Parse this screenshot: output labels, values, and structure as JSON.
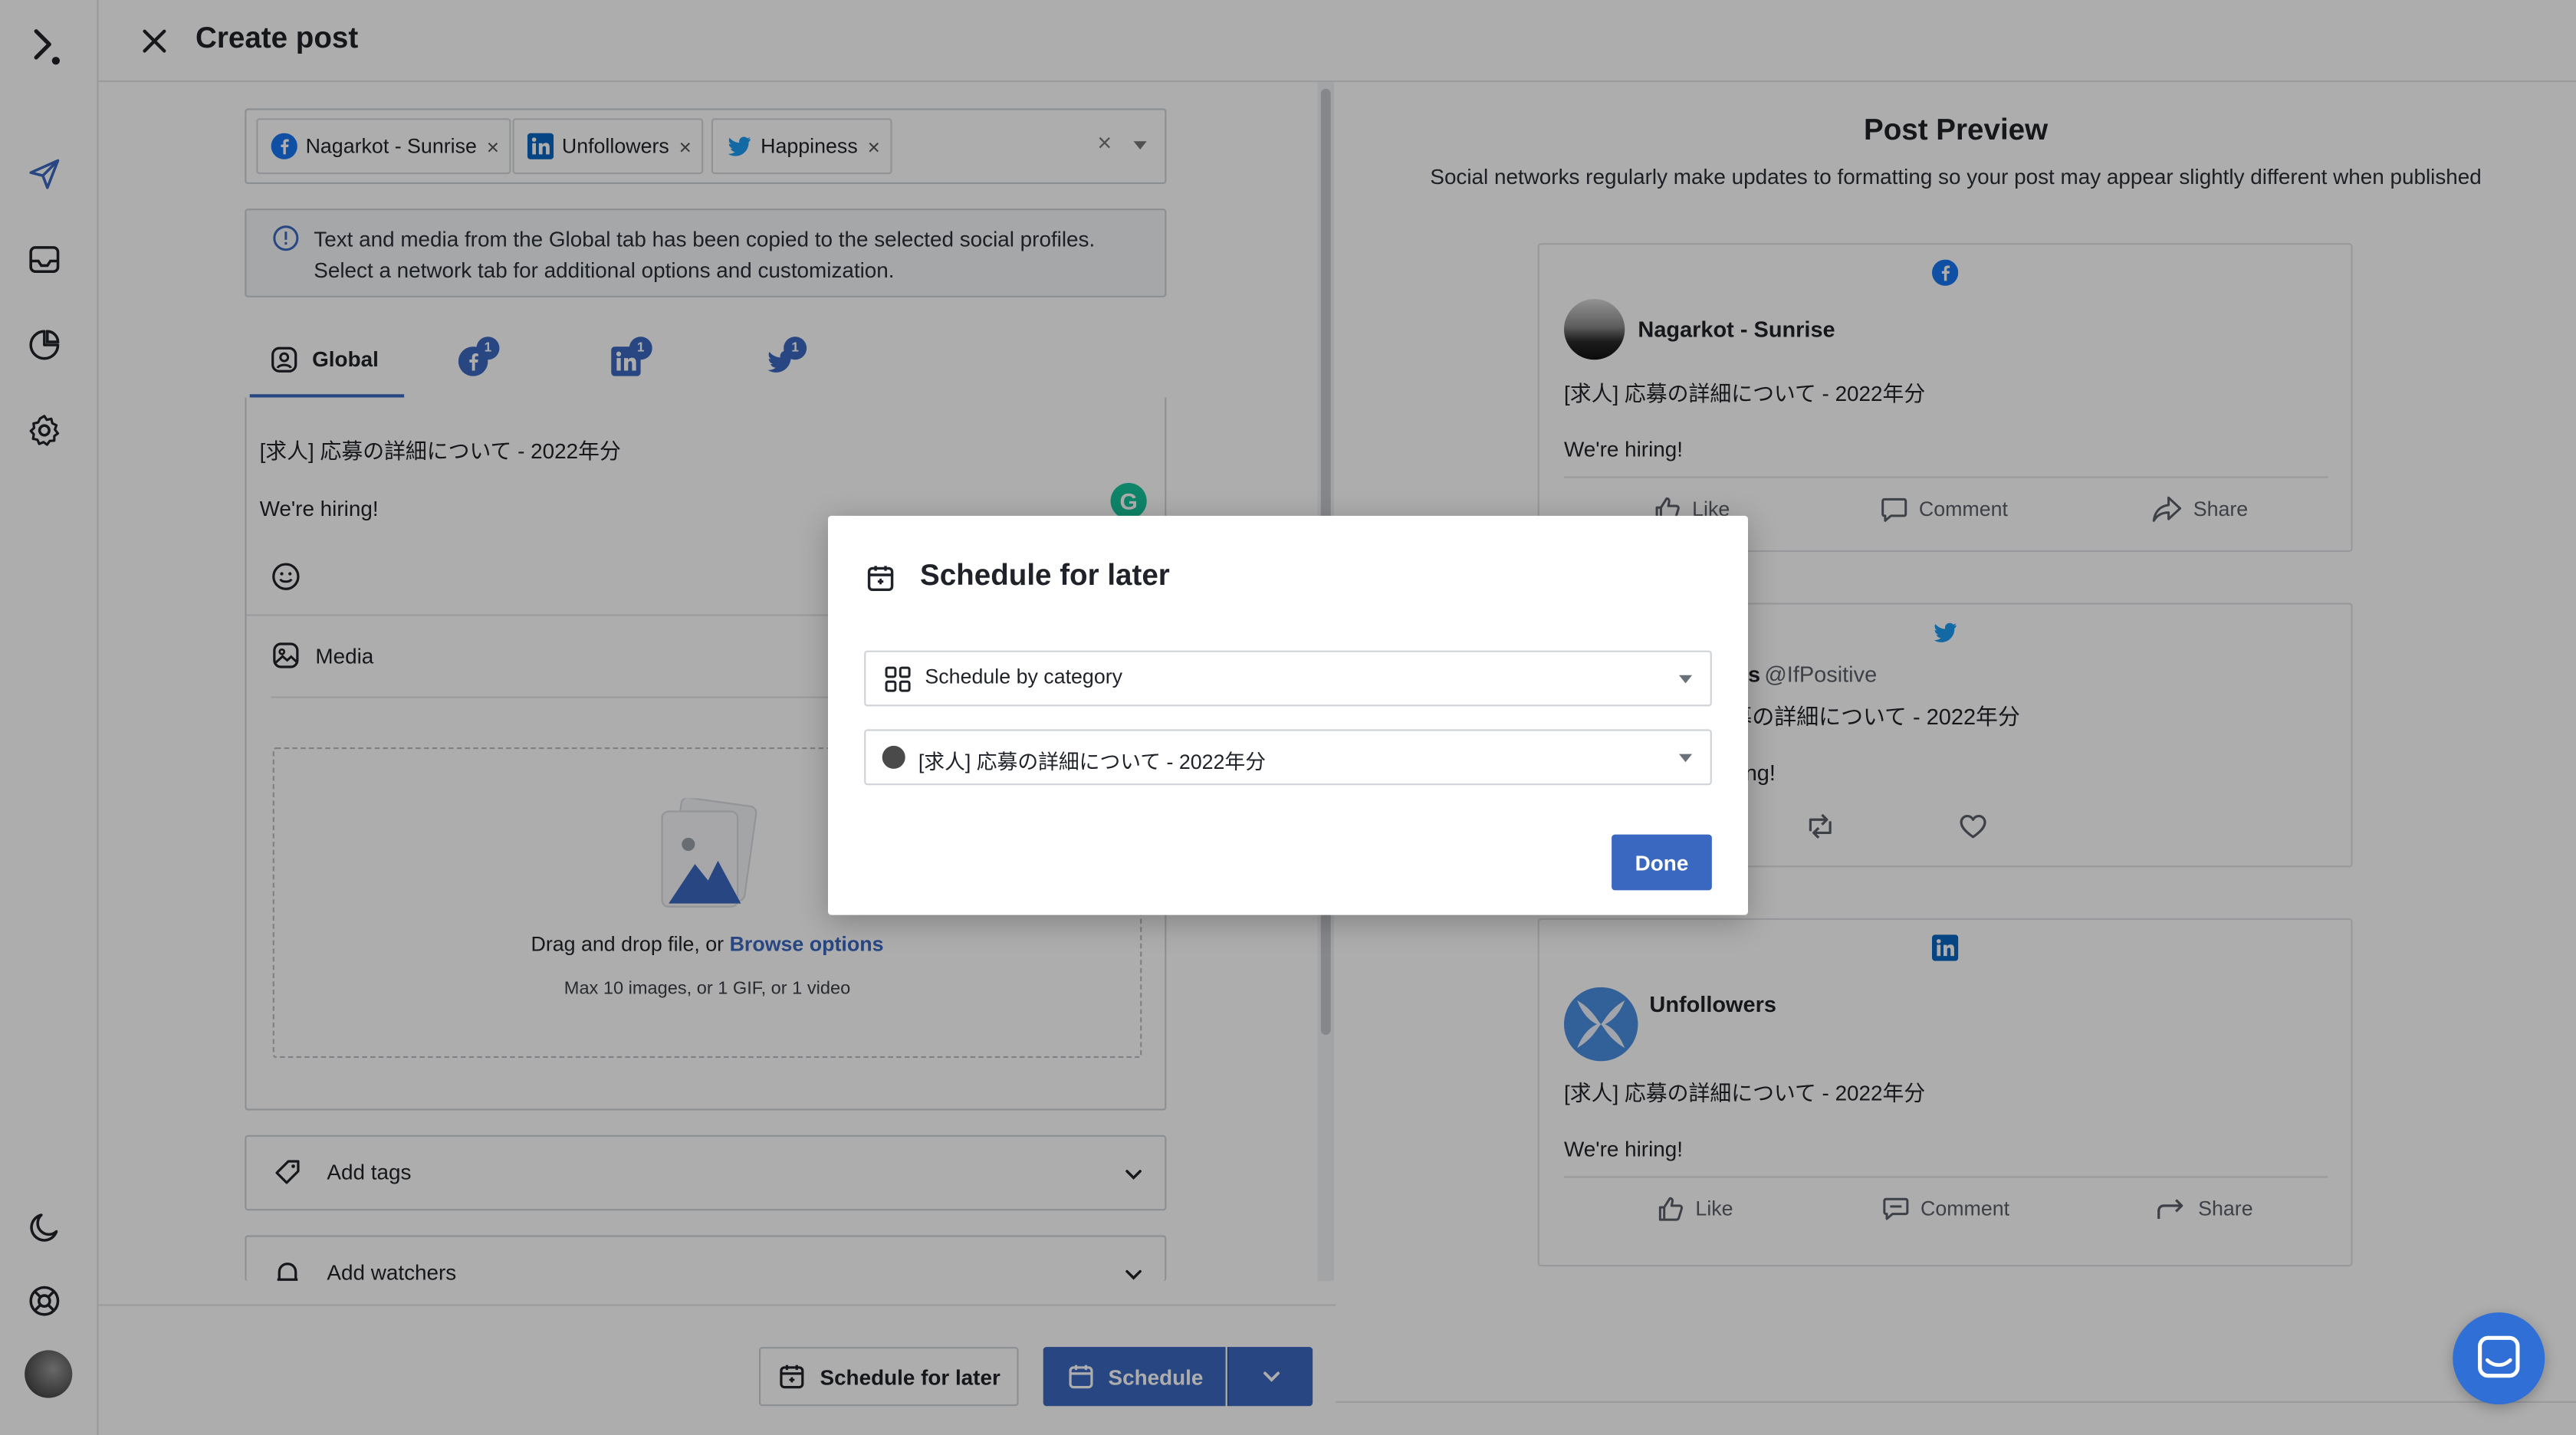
{
  "app": {
    "title": "Create post"
  },
  "profiles": {
    "chips": [
      {
        "label": "Nagarkot - Sunrise",
        "network": "facebook"
      },
      {
        "label": "Unfollowers",
        "network": "linkedin"
      },
      {
        "label": "Happiness",
        "network": "twitter"
      }
    ],
    "remove_glyph": "×",
    "clear_glyph": "×"
  },
  "info": {
    "line1": "Text and media from the Global tab has been copied to the selected social profiles.",
    "line2": "Select a network tab for additional options and customization."
  },
  "tabs": {
    "global_label": "Global",
    "facebook_badge": "1",
    "linkedin_badge": "1",
    "twitter_badge": "1"
  },
  "composer": {
    "line1": "[求人] 応募の詳細について - 2022年分",
    "line2": "We're hiring!",
    "grammarly_glyph": "G"
  },
  "media": {
    "label": "Media",
    "drop_text": "Drag and drop file, or ",
    "browse_link": "Browse options",
    "limits": "Max 10 images, or 1 GIF, or 1 video"
  },
  "sections": {
    "tags_label": "Add tags",
    "watchers_label": "Add watchers"
  },
  "footer": {
    "later_label": "Schedule for later",
    "schedule_label": "Schedule"
  },
  "preview": {
    "title": "Post Preview",
    "subtitle": "Social networks regularly make updates to formatting so your post may appear slightly different when published",
    "facebook": {
      "name": "Nagarkot - Sunrise",
      "text1": "[求人] 応募の詳細について - 2022年分",
      "text2": "We're hiring!",
      "like": "Like",
      "comment": "Comment",
      "share": "Share"
    },
    "twitter": {
      "name_tail": "s",
      "handle": "@IfPositive",
      "text1": "募の詳細について - 2022年分",
      "text2": "ng!"
    },
    "linkedin": {
      "name": "Unfollowers",
      "text1": "[求人] 応募の詳細について - 2022年分",
      "text2": "We're hiring!",
      "like": "Like",
      "comment": "Comment",
      "share": "Share"
    }
  },
  "modal": {
    "title": "Schedule for later",
    "mode_select": "Schedule by category",
    "category_select": "[求人] 応募の詳細について - 2022年分",
    "done_label": "Done"
  },
  "colors": {
    "accent": "#3a67c0",
    "facebook": "#1877f2",
    "twitter": "#1d9bf0",
    "linkedin": "#0a66c2",
    "chat": "#2f6fd6"
  }
}
